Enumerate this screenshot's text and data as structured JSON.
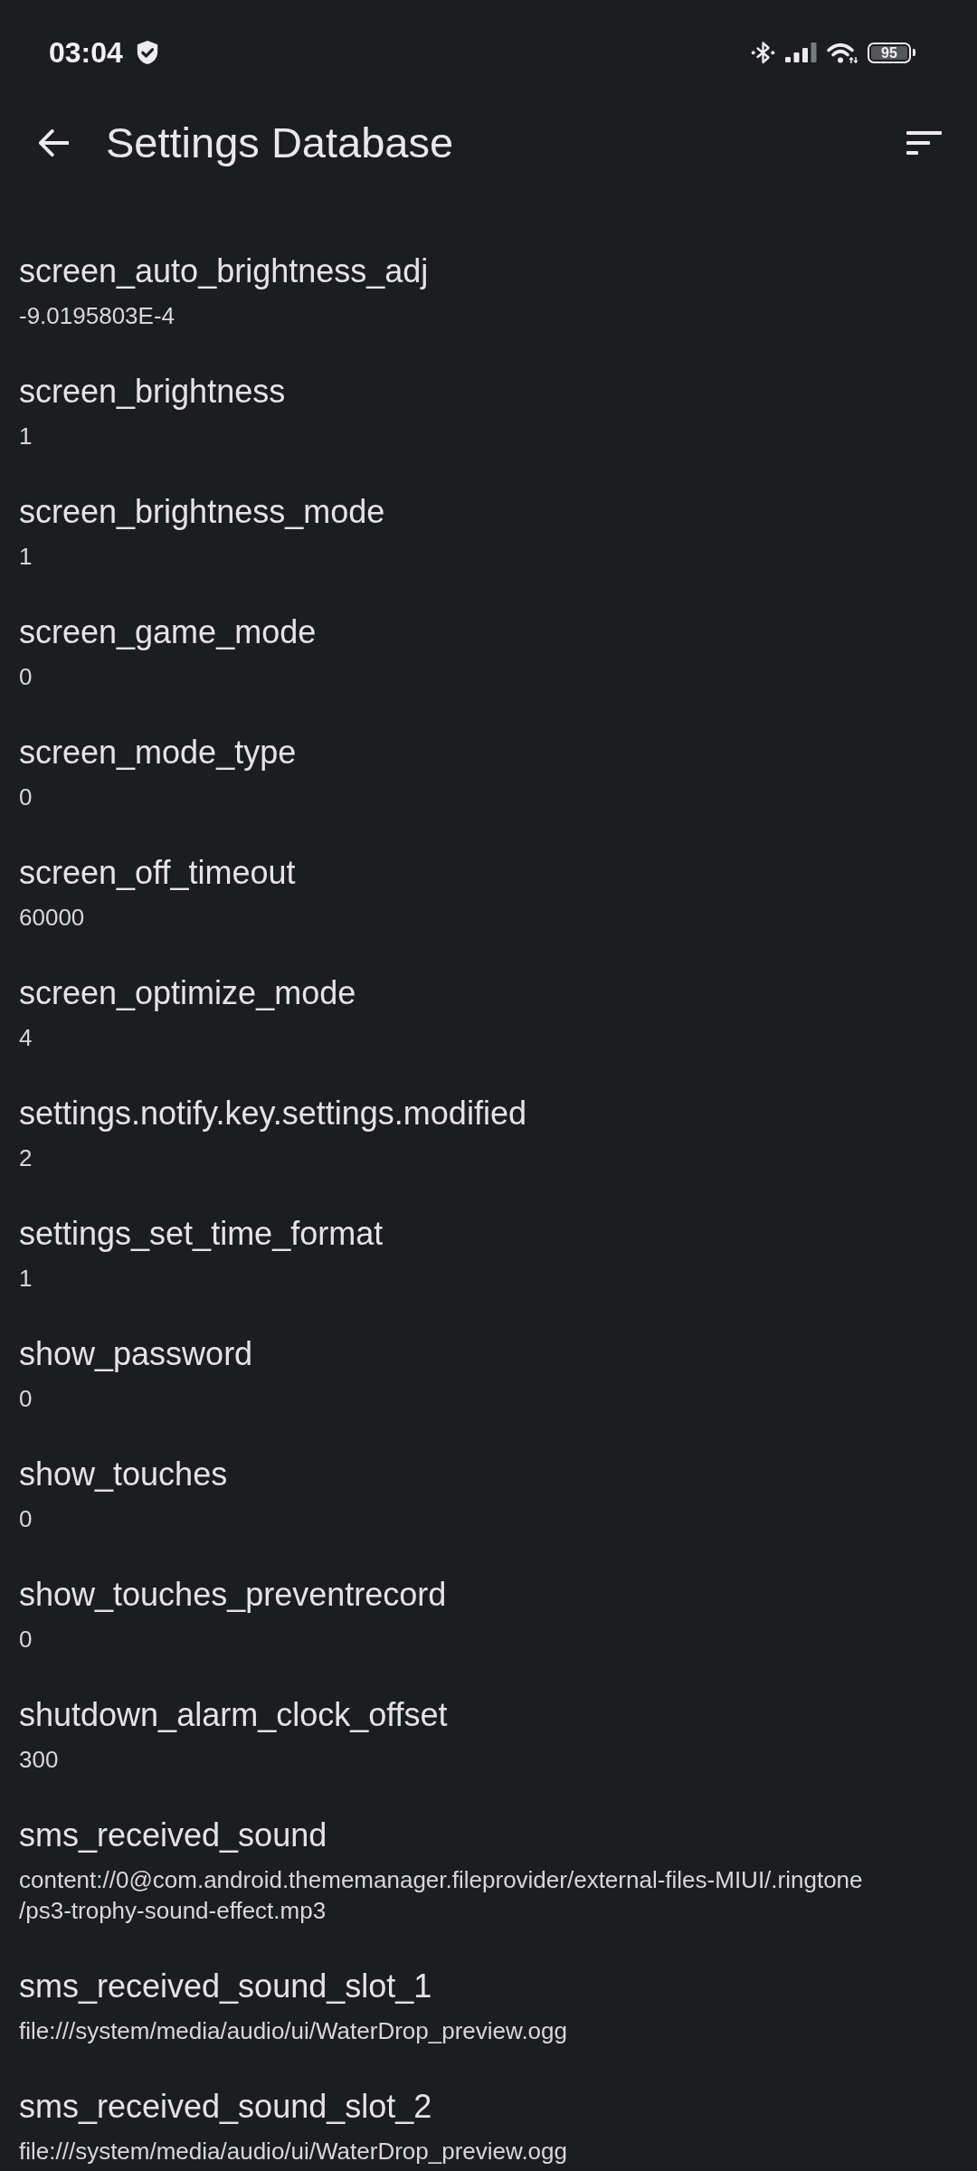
{
  "status_bar": {
    "time": "03:04",
    "battery": "95"
  },
  "app_bar": {
    "title": "Settings Database"
  },
  "settings": [
    {
      "key": "screen_auto_brightness_adj",
      "value": "-9.0195803E-4"
    },
    {
      "key": "screen_brightness",
      "value": "1"
    },
    {
      "key": "screen_brightness_mode",
      "value": "1"
    },
    {
      "key": "screen_game_mode",
      "value": "0"
    },
    {
      "key": "screen_mode_type",
      "value": "0"
    },
    {
      "key": "screen_off_timeout",
      "value": "60000"
    },
    {
      "key": "screen_optimize_mode",
      "value": "4"
    },
    {
      "key": "settings.notify.key.settings.modified",
      "value": "2"
    },
    {
      "key": "settings_set_time_format",
      "value": "1"
    },
    {
      "key": "show_password",
      "value": "0"
    },
    {
      "key": "show_touches",
      "value": "0"
    },
    {
      "key": "show_touches_preventrecord",
      "value": "0"
    },
    {
      "key": "shutdown_alarm_clock_offset",
      "value": "300"
    },
    {
      "key": "sms_received_sound",
      "value": "content://0@com.android.thememanager.fileprovider/external-files-MIUI/.ringtone\n/ps3-trophy-sound-effect.mp3"
    },
    {
      "key": "sms_received_sound_slot_1",
      "value": "file:///system/media/audio/ui/WaterDrop_preview.ogg"
    },
    {
      "key": "sms_received_sound_slot_2",
      "value": "file:///system/media/audio/ui/WaterDrop_preview.ogg"
    }
  ]
}
